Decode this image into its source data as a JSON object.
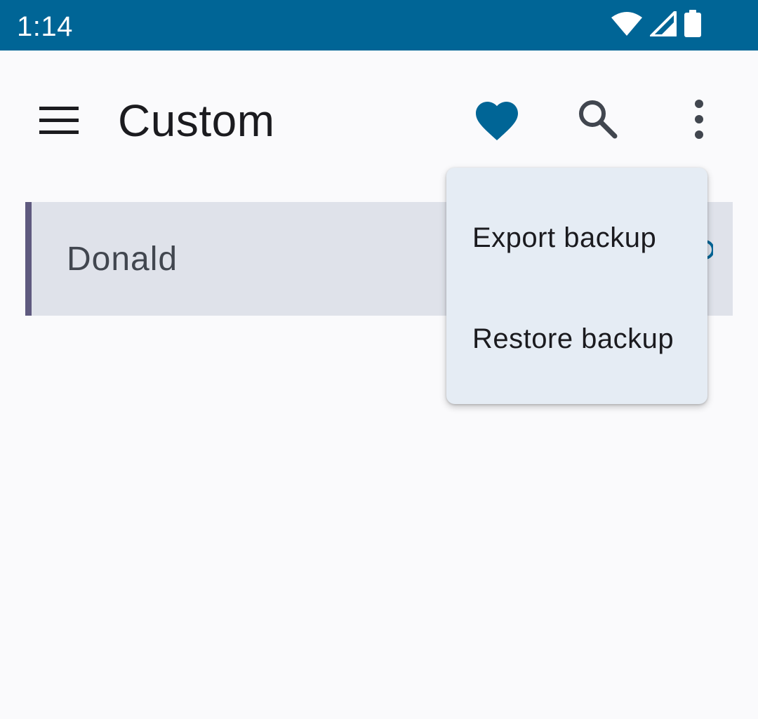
{
  "status_bar": {
    "time": "1:14",
    "icons": [
      "wifi-icon",
      "cellular-signal-icon",
      "battery-icon"
    ],
    "background": "#006596"
  },
  "app_bar": {
    "title": "Custom",
    "icons": [
      "menu-icon",
      "favorite-icon",
      "search-icon",
      "more-vert-icon"
    ],
    "accent": "#006596"
  },
  "list": {
    "items": [
      {
        "label": "Donald"
      }
    ]
  },
  "overflow_menu": {
    "items": [
      {
        "label": "Export backup"
      },
      {
        "label": "Restore backup"
      }
    ]
  }
}
